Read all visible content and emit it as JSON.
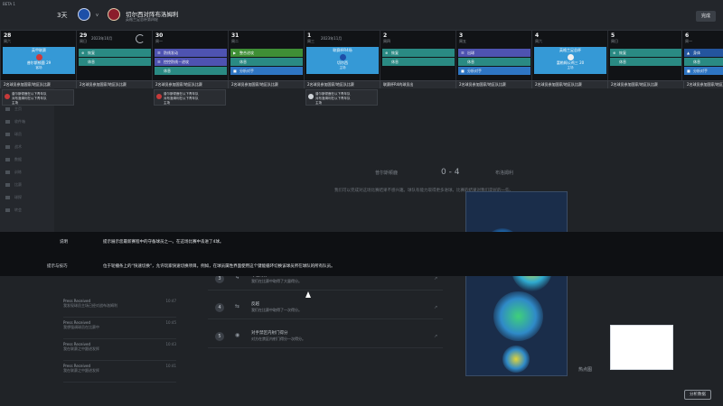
{
  "header": {
    "app_tag": "BETA 1",
    "days": "3天",
    "match_title": "切尔西对阵布洛姆利",
    "match_sub": "英格兰足总杯第四轮",
    "close_label": "完成",
    "vs": "v"
  },
  "calendar": {
    "month_1": "2023年10月",
    "month_2": "2023年11月",
    "days": [
      {
        "num": "28",
        "wd": "周六"
      },
      {
        "num": "29",
        "wd": "周日"
      },
      {
        "num": "30",
        "wd": "周一"
      },
      {
        "num": "31",
        "wd": "周二"
      },
      {
        "num": "1",
        "wd": "周三"
      },
      {
        "num": "2",
        "wd": "周四"
      },
      {
        "num": "3",
        "wd": "周五"
      },
      {
        "num": "4",
        "wd": "周六"
      },
      {
        "num": "5",
        "wd": "周日"
      },
      {
        "num": "6",
        "wd": "周一"
      }
    ],
    "match_cards": {
      "d0": {
        "t1": "英甲联赛",
        "t2": "普尔斯顿鹿 29",
        "t3": "客场"
      },
      "d4": {
        "t1": "联赛杯R4场",
        "t2": "切尔西",
        "t3": "主场"
      },
      "d7": {
        "t1": "英格兰足总杯",
        "t2": "富勒姆公鸡三 20",
        "t3": "主场"
      }
    },
    "bars": {
      "recovery": "恢复",
      "rest": "休息",
      "attack_drill": "防线发动",
      "defense_drill": "控控防线－进攻",
      "match_prep": "比赛准备",
      "analysis": "分析对手",
      "fitness": "整合进攻",
      "physical": "身体",
      "set_piece": "出球"
    },
    "footer": [
      "2名球员参加国家/地区队比赛",
      "2名球员参加国家/地区队比赛",
      "2名球员参加国家/地区队比赛",
      "2名球员参加国家/地区队比赛",
      "2名球员参加国家/地区队比赛",
      "联赛杯R4的球员出",
      "2名球员参加国家/地区队比赛",
      "2名球员参加国家/地区队比赛",
      "2名球员参加国家/地区队比赛",
      "2名球员参加国家/地区队比赛"
    ],
    "popups": {
      "p0": {
        "l1": "普尔斯顿鹿在以下青年队",
        "l2": "对布洛姆利在以下青年队",
        "l3": "主场"
      },
      "p2": {
        "l1": "普尔斯顿鹿在以下青年队",
        "l2": "对布洛姆利在以下青年队",
        "l3": "主场"
      },
      "p4": {
        "l1": "普尔斯顿鹿在以下青年队",
        "l2": "对布洛姆利在以下青年队",
        "l3": "主场"
      }
    }
  },
  "backdrop": {
    "nav": [
      "主页",
      "收件箱",
      "球员",
      "战术",
      "数据",
      "训练",
      "比赛",
      "球探",
      "转会"
    ],
    "score": {
      "home": "普尔斯顿鹿",
      "score": "0 - 4",
      "away": "布洛姆利",
      "note": "我们可以完成对这场比赛结果不感兴趣。球队有能力取得更多进球。比赛的结果对我们是好的一些。"
    },
    "steps": [
      {
        "num": "3",
        "title": "守住比分",
        "desc": "我们在比赛中取得了大量得分。"
      },
      {
        "num": "4",
        "title": "反越",
        "desc": "我们在比赛中取得了一次得分。"
      },
      {
        "num": "5",
        "title": "对手禁区内射门得分",
        "desc": "对方在禁区内射门得分一次得分。"
      }
    ],
    "feed": [
      {
        "who": "Press Received",
        "text": "我发现球员主场已经对战布洛姆利",
        "time": "10:47"
      },
      {
        "who": "Press Received",
        "text": "我想强调球员在比赛中",
        "time": "10:45"
      },
      {
        "who": "Press Received",
        "text": "我在联赛之中跟进发挥",
        "time": "10:43"
      },
      {
        "who": "Press Received",
        "text": "我在联赛之中跟进发挥",
        "time": "10:41"
      }
    ],
    "side_title": "热点图",
    "analysis_label": "分析数据"
  },
  "overlay": {
    "row1_label": "说明",
    "row1_text": "提示展示您最新赛程中的守备球员之一。在这场比赛中丢进了4球。",
    "row2_label": "提示与技巧",
    "row2_text": "位于轮播条上的“快速切换”，允许玩家快速切换项目。例如，在球员属性界面使用这个键能循环切换该球员所在球队的所有队员。"
  }
}
